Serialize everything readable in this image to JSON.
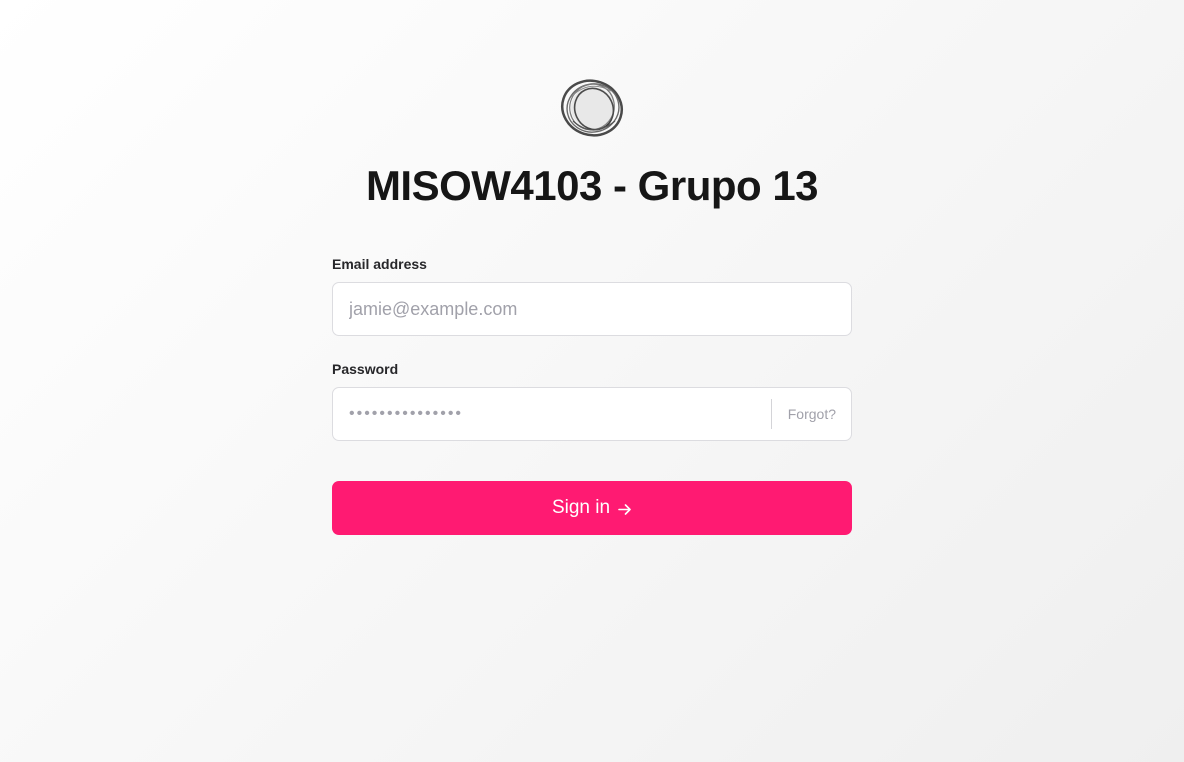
{
  "app": {
    "title": "MISOW4103 - Grupo 13",
    "logo_icon": "ring-logo-icon"
  },
  "form": {
    "email": {
      "label": "Email address",
      "placeholder": "jamie@example.com",
      "value": ""
    },
    "password": {
      "label": "Password",
      "placeholder": "•••••••••••••••",
      "value": "",
      "forgot_label": "Forgot?"
    },
    "submit": {
      "label": "Sign in",
      "icon": "arrow-right-icon"
    }
  },
  "colors": {
    "accent": "#ff1a72",
    "title": "#161616",
    "muted": "#a1a1aa"
  }
}
